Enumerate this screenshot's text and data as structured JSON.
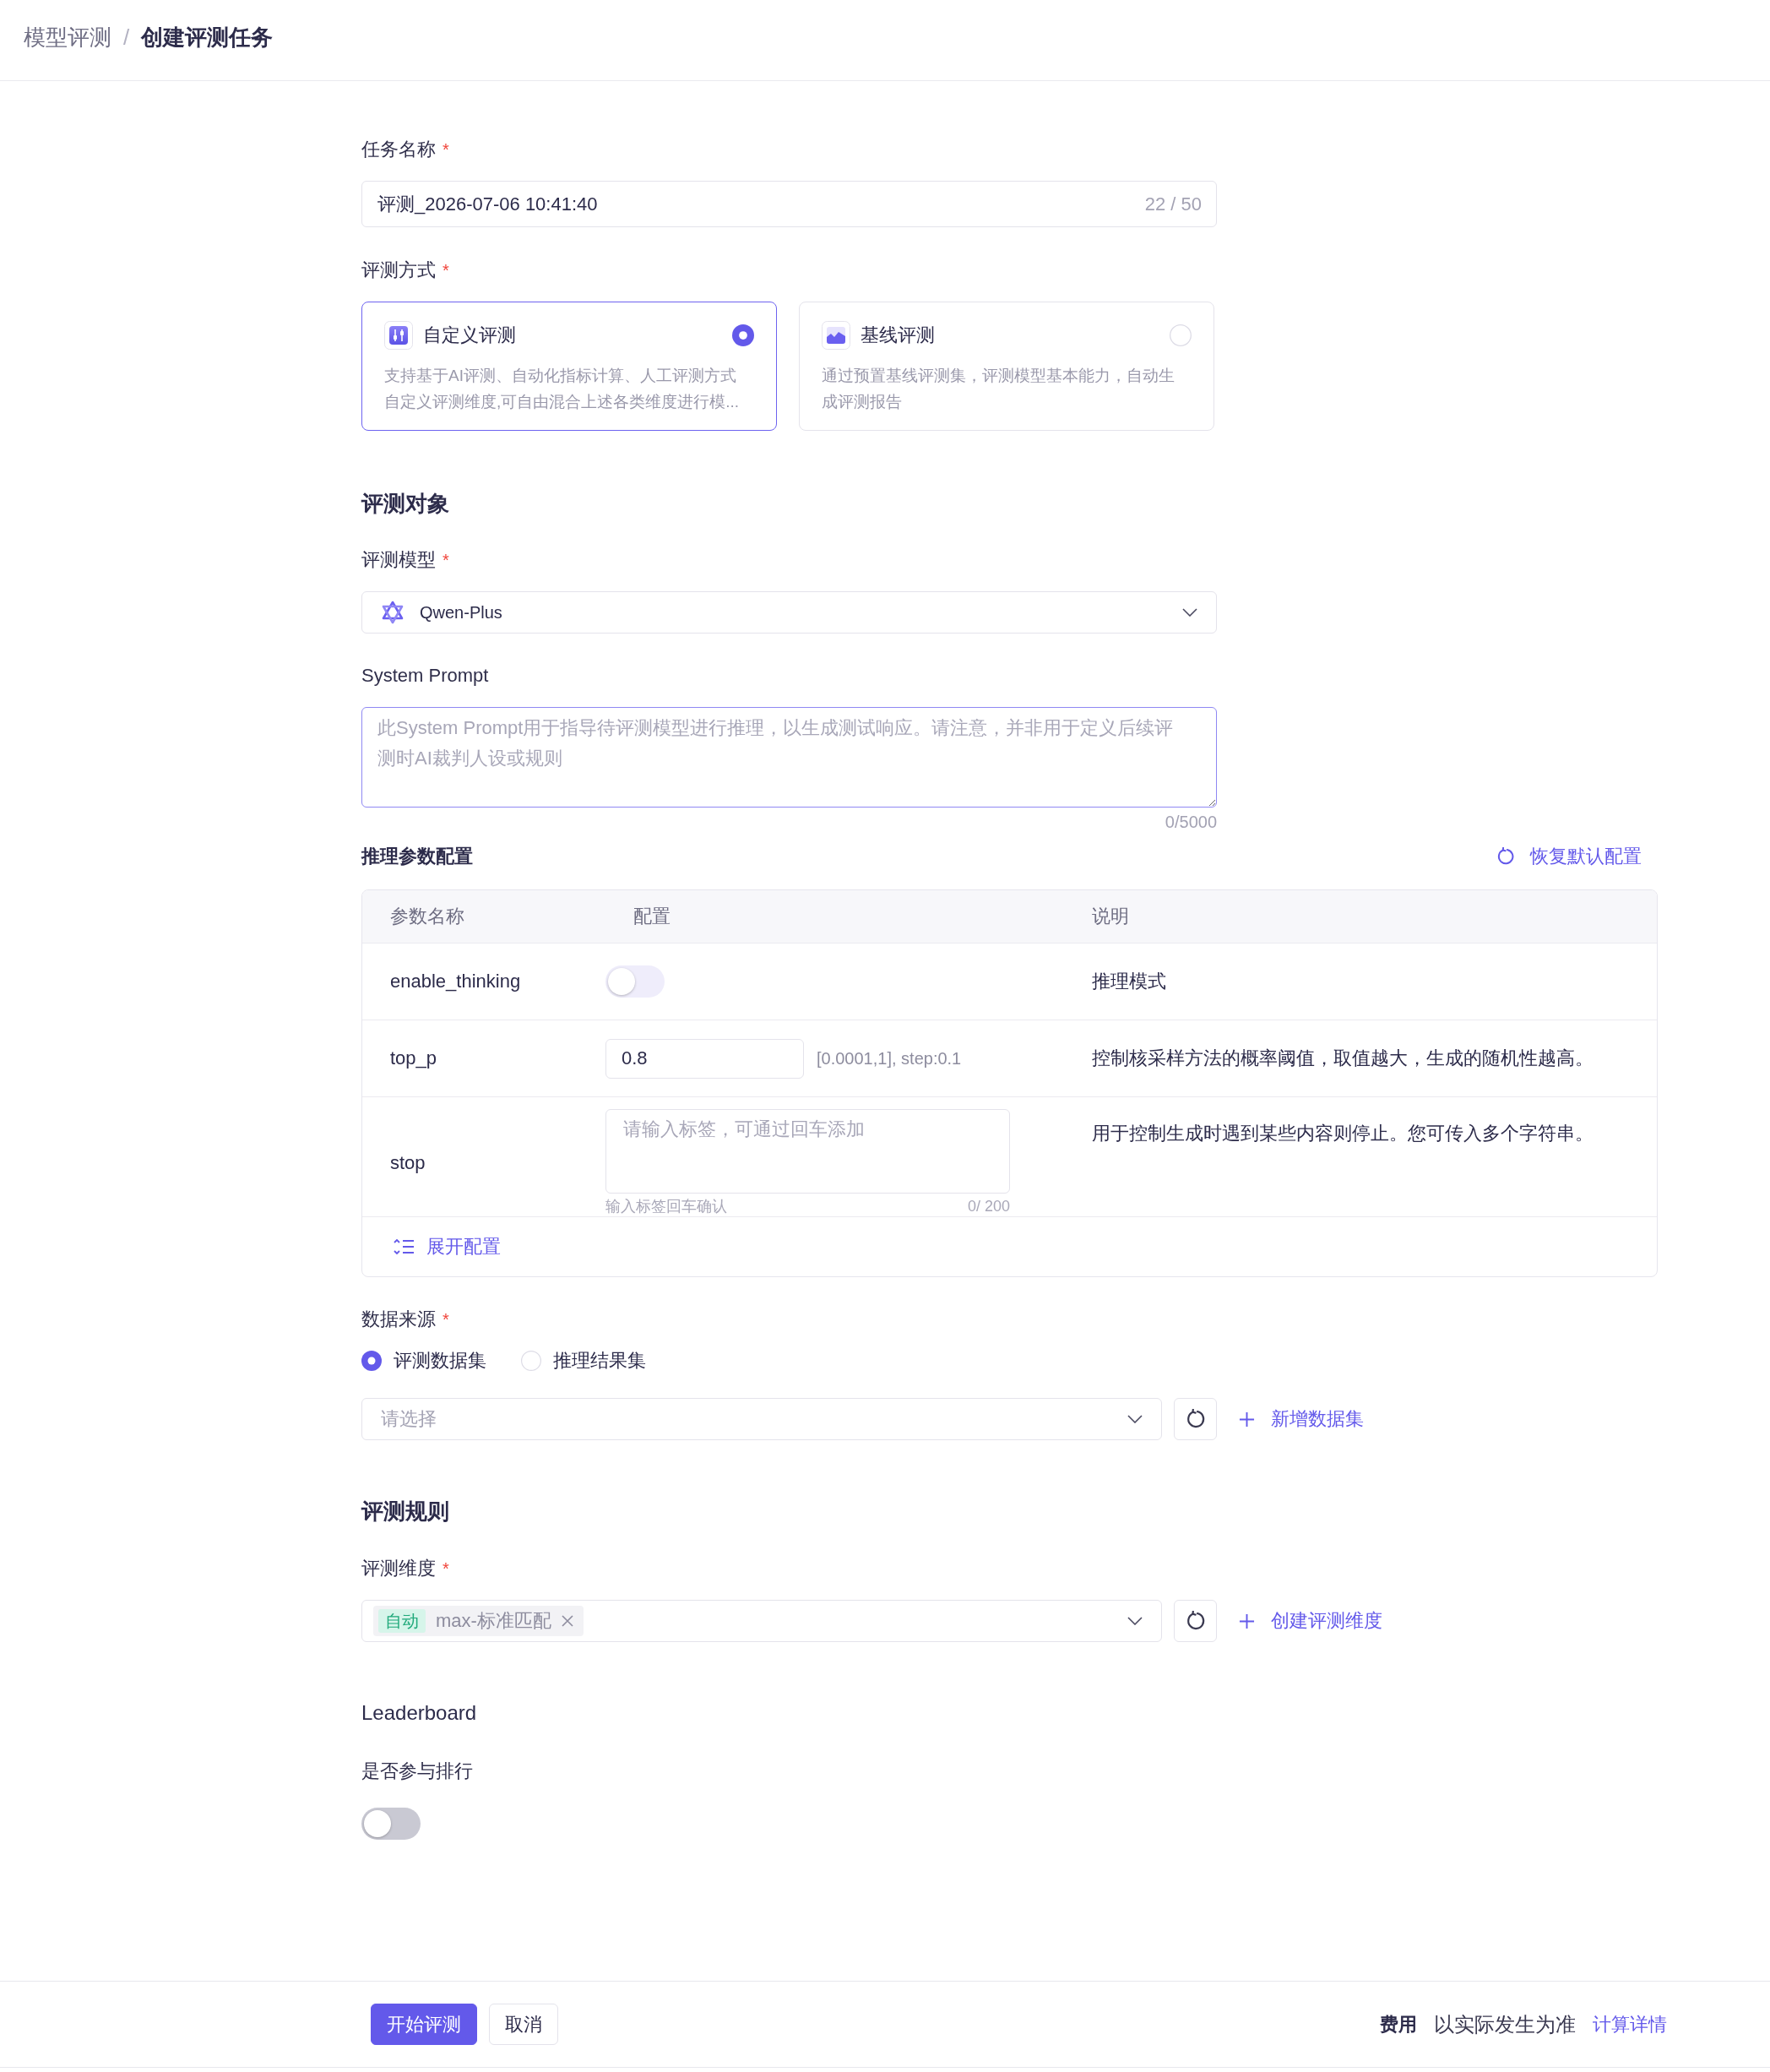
{
  "breadcrumb": {
    "separator": "/",
    "items": [
      {
        "label": "模型评测"
      },
      {
        "label": "创建评测任务"
      }
    ]
  },
  "task_name": {
    "label": "任务名称",
    "required_mark": "*",
    "value": "评测_2026-07-06 10:41:40",
    "counter": "22 / 50"
  },
  "eval_method": {
    "label": "评测方式",
    "required_mark": "*",
    "options": [
      {
        "kind": "custom",
        "title": "自定义评测",
        "description": "支持基于AI评测、自动化指标计算、人工评测方式自定义评测维度,可自由混合上述各类维度进行模...",
        "selected": true
      },
      {
        "kind": "baseline",
        "title": "基线评测",
        "description": "通过预置基线评测集，评测模型基本能力，自动生成评测报告",
        "selected": false
      }
    ]
  },
  "target_section": {
    "title": "评测对象"
  },
  "model": {
    "label": "评测模型",
    "required_mark": "*",
    "value": "Qwen-Plus"
  },
  "system_prompt": {
    "label": "System Prompt",
    "placeholder": "此System Prompt用于指导待评测模型进行推理，以生成测试响应。请注意，并非用于定义后续评测时AI裁判人设或规则",
    "counter": "0/5000"
  },
  "inference_params": {
    "label": "推理参数配置",
    "reset_link": "恢复默认配置",
    "columns": [
      "参数名称",
      "配置",
      "说明"
    ],
    "rows": [
      {
        "kind": "switch",
        "name": "enable_thinking",
        "on": false,
        "disabled": true,
        "description": "推理模式"
      },
      {
        "kind": "number",
        "name": "top_p",
        "value": "0.8",
        "range": "[0.0001,1], step:0.1",
        "description": "控制核采样方法的概率阈值，取值越大，生成的随机性越高。"
      },
      {
        "kind": "tags",
        "name": "stop",
        "placeholder": "请输入标签，可通过回车添加",
        "hint": "输入标签回车确认",
        "counter": "0/ 200",
        "description": "用于控制生成时遇到某些内容则停止。您可传入多个字符串。"
      }
    ],
    "expand_link": "展开配置"
  },
  "data_source": {
    "label": "数据来源",
    "required_mark": "*",
    "options": [
      {
        "label": "评测数据集",
        "selected": true
      },
      {
        "label": "推理结果集",
        "selected": false
      }
    ],
    "placeholder": "请选择",
    "add_link": "新增数据集"
  },
  "rules_section": {
    "title": "评测规则"
  },
  "dimension": {
    "label": "评测维度",
    "required_mark": "*",
    "tags": [
      {
        "badge": "自动",
        "label": "max-标准匹配"
      }
    ],
    "add_link": "创建评测维度"
  },
  "leaderboard": {
    "title": "Leaderboard",
    "label": "是否参与排行",
    "on": false
  },
  "footer": {
    "buttons": [
      {
        "kind": "primary",
        "label": "开始评测"
      },
      {
        "kind": "default",
        "label": "取消"
      }
    ],
    "cost_label": "费用",
    "cost_value": "以实际发生为准",
    "detail_link": "计算详情"
  }
}
